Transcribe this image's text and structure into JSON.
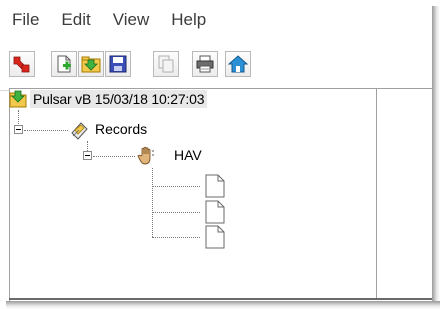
{
  "menu": {
    "items": [
      {
        "label": "File"
      },
      {
        "label": "Edit"
      },
      {
        "label": "View"
      },
      {
        "label": "Help"
      }
    ]
  },
  "toolbar": {
    "buttons": [
      {
        "icon": "exit-arrow-icon"
      },
      {
        "icon": "new-document-icon"
      },
      {
        "icon": "import-folder-icon"
      },
      {
        "icon": "save-disk-icon"
      },
      {
        "icon": "copy-icon"
      },
      {
        "icon": "print-icon"
      },
      {
        "icon": "home-icon"
      }
    ]
  },
  "tree": {
    "root": {
      "label": "Pulsar vB 15/03/18 10:27:03",
      "icon": "folder-download-icon"
    },
    "records": {
      "label": "Records",
      "icon": "records-icon"
    },
    "hav": {
      "label": "HAV",
      "icon": "hand-vibration-icon"
    },
    "documents": [
      {
        "icon": "document-icon"
      },
      {
        "icon": "document-icon"
      },
      {
        "icon": "document-icon"
      }
    ]
  },
  "colors": {
    "selection_bg": "#e8e8e8",
    "folder_green": "#3fb33f",
    "folder_yellow": "#f2c94c"
  }
}
